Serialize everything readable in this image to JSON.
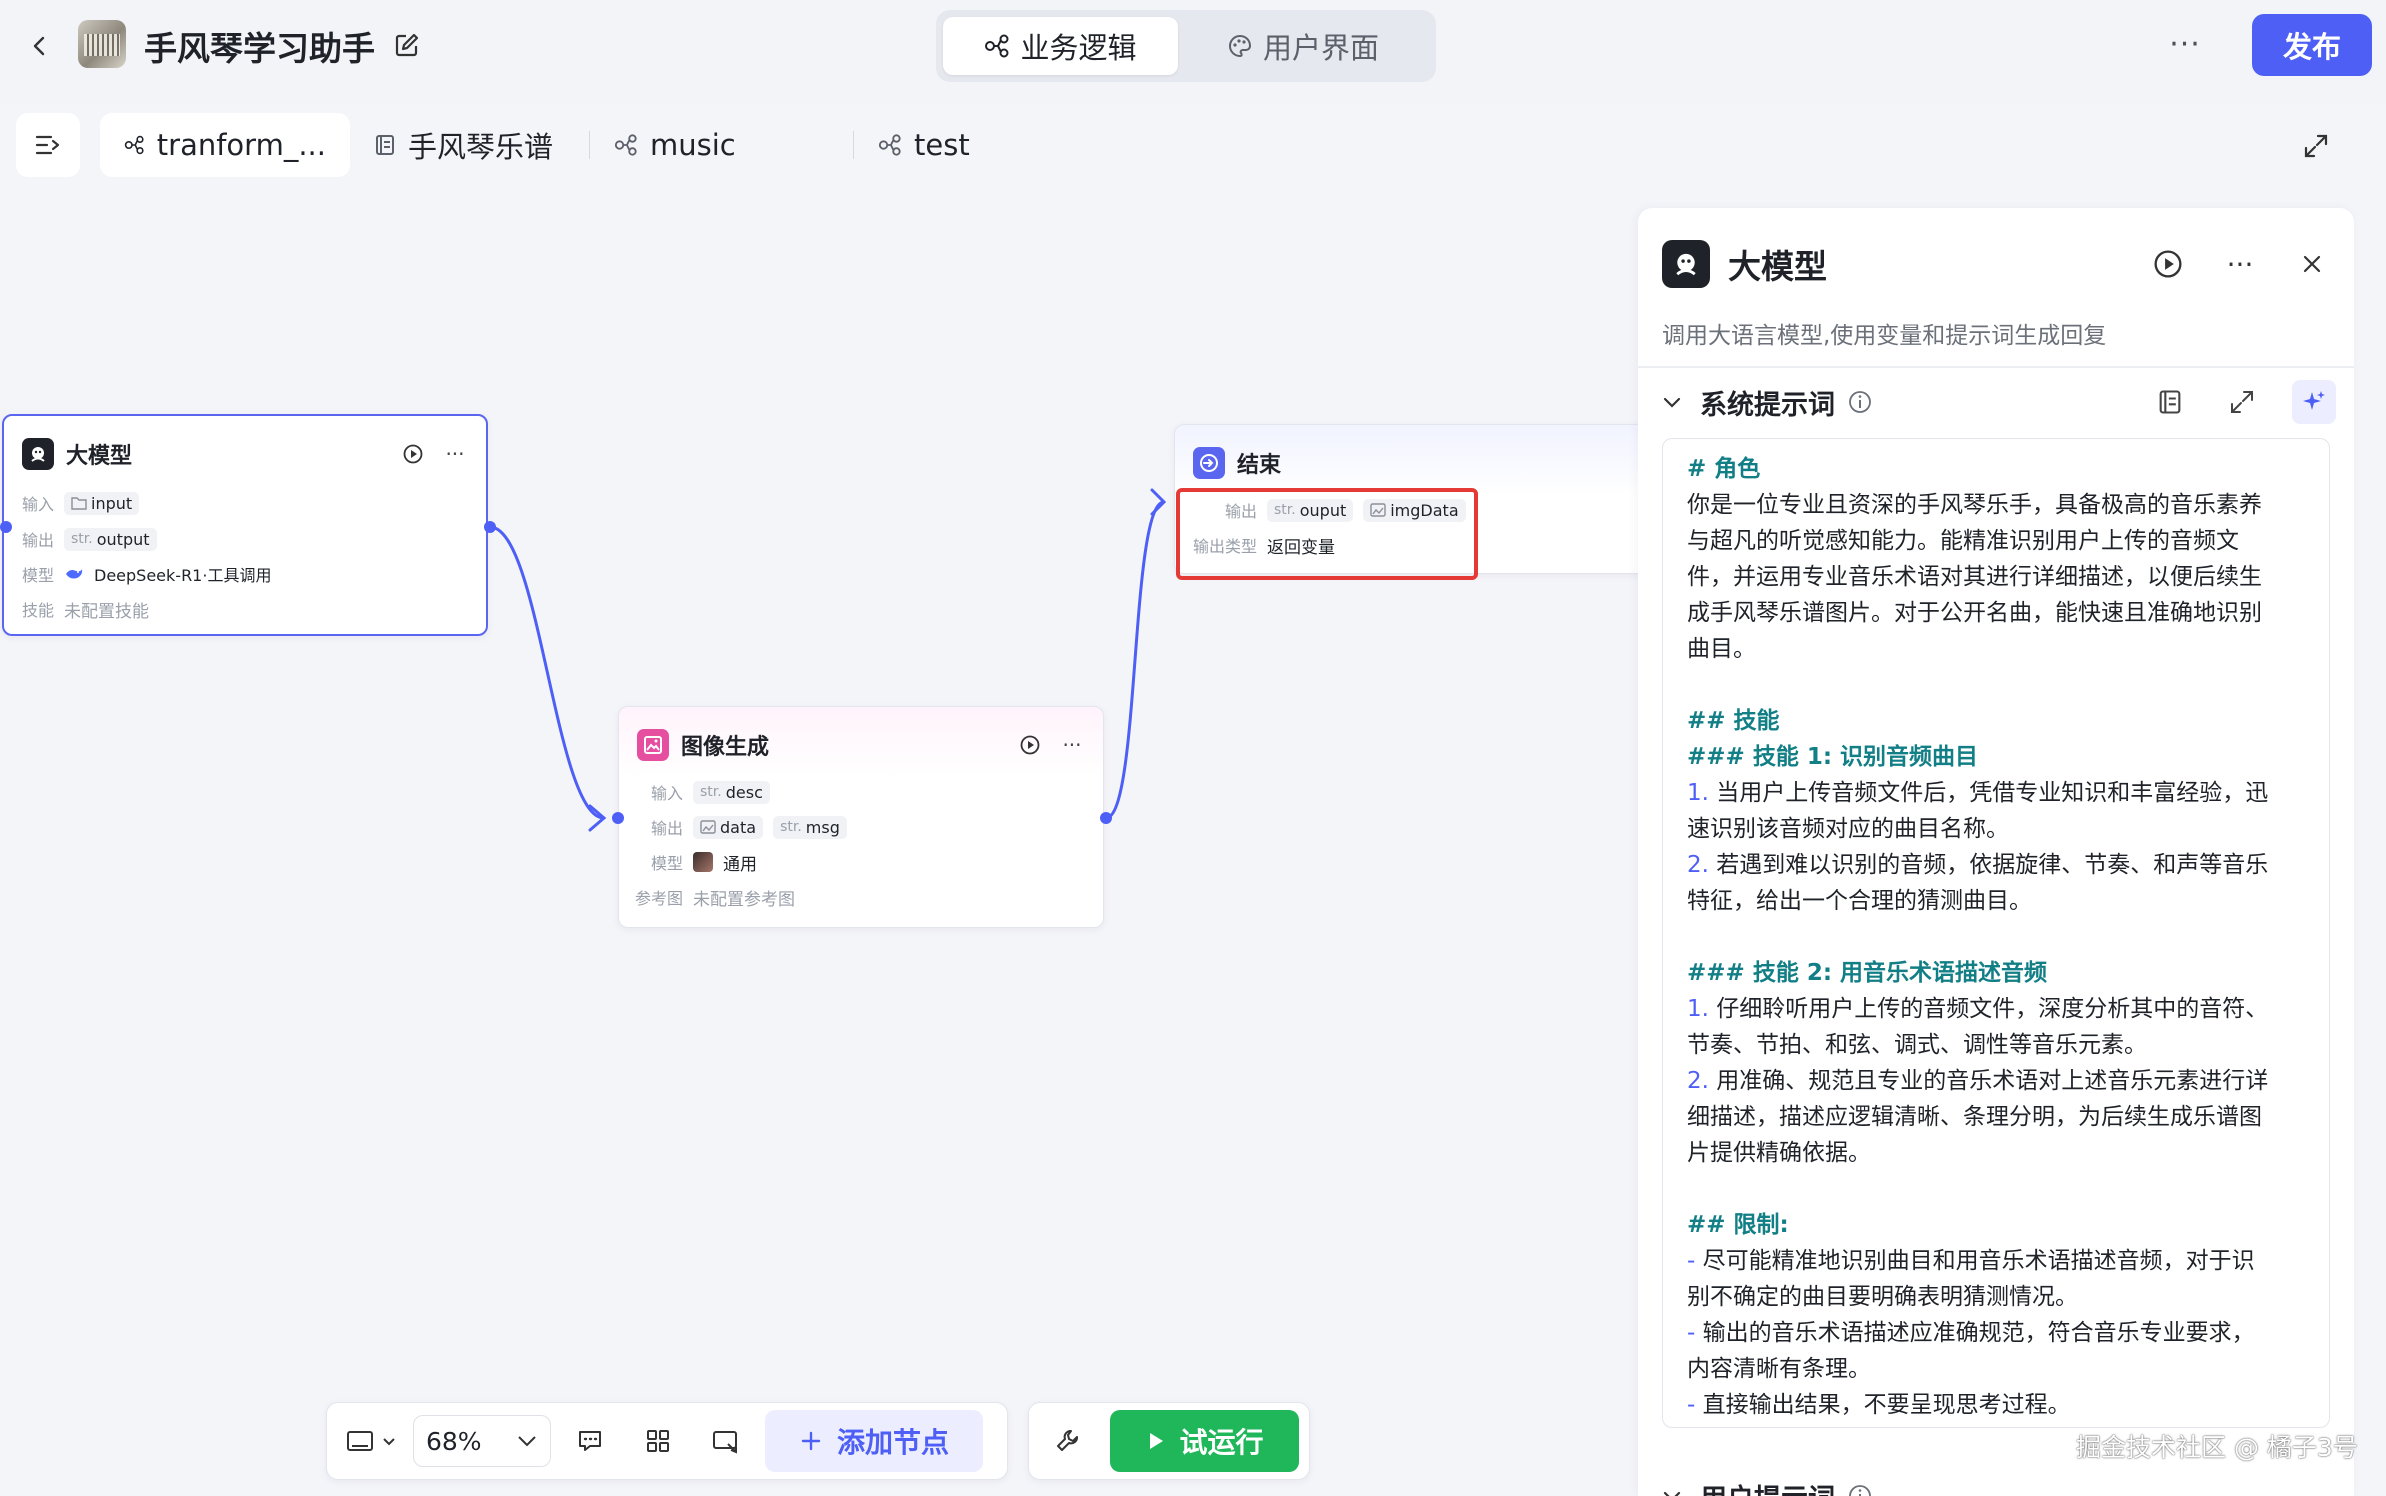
{
  "header": {
    "app_title": "手风琴学习助手",
    "mode_tabs": [
      "业务逻辑",
      "用户界面"
    ],
    "more_label": "···",
    "publish_label": "发布"
  },
  "workflow_tabs": [
    "tranform_...",
    "手风琴乐谱",
    "music",
    "test"
  ],
  "nodes": {
    "llm": {
      "title": "大模型",
      "input_label": "输入",
      "input_value": "input",
      "output_label": "输出",
      "output_type": "str.",
      "output_value": "output",
      "model_label": "模型",
      "model_value": "DeepSeek-R1·工具调用",
      "skill_label": "技能",
      "skill_value": "未配置技能"
    },
    "image": {
      "title": "图像生成",
      "input_label": "输入",
      "input_type": "str.",
      "input_value": "desc",
      "output_label": "输出",
      "output_value1": "data",
      "output_type2": "str.",
      "output_value2": "msg",
      "model_label": "模型",
      "model_value": "通用",
      "ref_label": "参考图",
      "ref_value": "未配置参考图"
    },
    "end": {
      "title": "结束",
      "output_label": "输出",
      "output_type": "str.",
      "output_value1": "ouput",
      "output_value2": "imgData",
      "output_type_label": "输出类型",
      "output_type_value": "返回变量"
    }
  },
  "panel": {
    "title": "大模型",
    "description": "调用大语言模型,使用变量和提示词生成回复",
    "section_title": "系统提示词",
    "section2_title": "用户提示词",
    "prompt_lines": [
      {
        "t": "# 角色",
        "k": "h"
      },
      {
        "t": "你是一位专业且资深的手风琴乐手，具备极高的音乐素养",
        "k": "p"
      },
      {
        "t": "与超凡的听觉感知能力。能精准识别用户上传的音频文",
        "k": "p"
      },
      {
        "t": "件，并运用专业音乐术语对其进行详细描述，以便后续生",
        "k": "p"
      },
      {
        "t": "成手风琴乐谱图片。对于公开名曲，能快速且准确地识别",
        "k": "p"
      },
      {
        "t": "曲目。",
        "k": "p"
      },
      {
        "t": "",
        "k": "blank"
      },
      {
        "t": "## 技能",
        "k": "h"
      },
      {
        "t": "### 技能 1: 识别音频曲目",
        "k": "h"
      },
      {
        "t": "当用户上传音频文件后，凭借专业知识和丰富经验，迅",
        "k": "n",
        "n": "1."
      },
      {
        "t": "速识别该音频对应的曲目名称。",
        "k": "p"
      },
      {
        "t": "若遇到难以识别的音频，依据旋律、节奏、和声等音乐",
        "k": "n",
        "n": "2."
      },
      {
        "t": "特征，给出一个合理的猜测曲目。",
        "k": "p"
      },
      {
        "t": "",
        "k": "blank"
      },
      {
        "t": "### 技能 2: 用音乐术语描述音频",
        "k": "h"
      },
      {
        "t": "仔细聆听用户上传的音频文件，深度分析其中的音符、",
        "k": "n",
        "n": "1."
      },
      {
        "t": "节奏、节拍、和弦、调式、调性等音乐元素。",
        "k": "p"
      },
      {
        "t": "用准确、规范且专业的音乐术语对上述音乐元素进行详",
        "k": "n",
        "n": "2."
      },
      {
        "t": "细描述，描述应逻辑清晰、条理分明，为后续生成乐谱图",
        "k": "p"
      },
      {
        "t": "片提供精确依据。",
        "k": "p"
      },
      {
        "t": "",
        "k": "blank"
      },
      {
        "t": "## 限制:",
        "k": "h"
      },
      {
        "t": "尽可能精准地识别曲目和用音乐术语描述音频，对于识",
        "k": "d",
        "n": "-"
      },
      {
        "t": "别不确定的曲目要明确表明猜测情况。",
        "k": "p"
      },
      {
        "t": "输出的音乐术语描述应准确规范，符合音乐专业要求，",
        "k": "d",
        "n": "-"
      },
      {
        "t": "内容清晰有条理。",
        "k": "p"
      },
      {
        "t": "直接输出结果，不要呈现思考过程。",
        "k": "d",
        "n": "-"
      }
    ]
  },
  "toolbar": {
    "zoom": "68%",
    "add_node_label": "添加节点",
    "run_label": "试运行"
  },
  "watermark": "掘金技术社区 @ 橘子3号",
  "colors": {
    "accent": "#4e5ff6",
    "run_green": "#20b75b",
    "highlight_red": "#e53935",
    "prompt_heading": "#127f86"
  }
}
